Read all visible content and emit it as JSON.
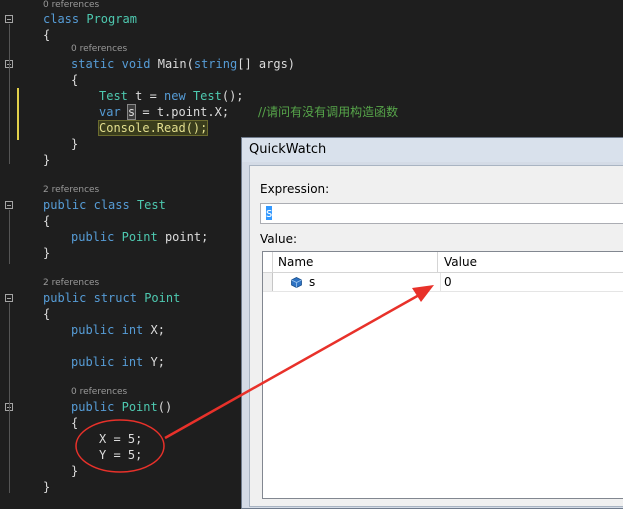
{
  "editor": {
    "refs": {
      "program": "0 references",
      "main": "0 references",
      "test": "2 references",
      "point_struct": "2 references",
      "point_ctor": "0 references"
    },
    "code": {
      "class_kw": "class",
      "program_name": "Program",
      "open_brace": "{",
      "close_brace": "}",
      "static_kw": "static",
      "void_kw": "void",
      "main_name": "Main(",
      "string_kw": "string",
      "args": "[] args)",
      "test_type": "Test",
      "t_assign": " t = ",
      "new_kw": "new",
      "test_ctor": " Test",
      "call_end": "();",
      "var_kw": "var",
      "s_var": "s",
      "s_assign": " = t.point.X;",
      "comment": "//请问有没有调用构造函数",
      "console_read": "Console.Read();",
      "public_kw": "public",
      "point_type": "Point",
      "point_field": " point;",
      "struct_kw": "struct",
      "int_kw": "int",
      "x_field": " X;",
      "y_field": " Y;",
      "point_ctor": "Point",
      "ctor_parens": "()",
      "x_assign": "X = 5;",
      "y_assign": "Y = 5;"
    }
  },
  "quickwatch": {
    "title": "QuickWatch",
    "expression_label": "Expression:",
    "expression_value": "s",
    "value_label": "Value:",
    "columns": [
      "Name",
      "Value"
    ],
    "rows": [
      {
        "name": "s",
        "value": "0"
      }
    ]
  },
  "colors": {
    "annotation_red": "#e8312a",
    "keyword": "#569cd6",
    "type": "#4ec9b0",
    "comment": "#57a64a"
  }
}
